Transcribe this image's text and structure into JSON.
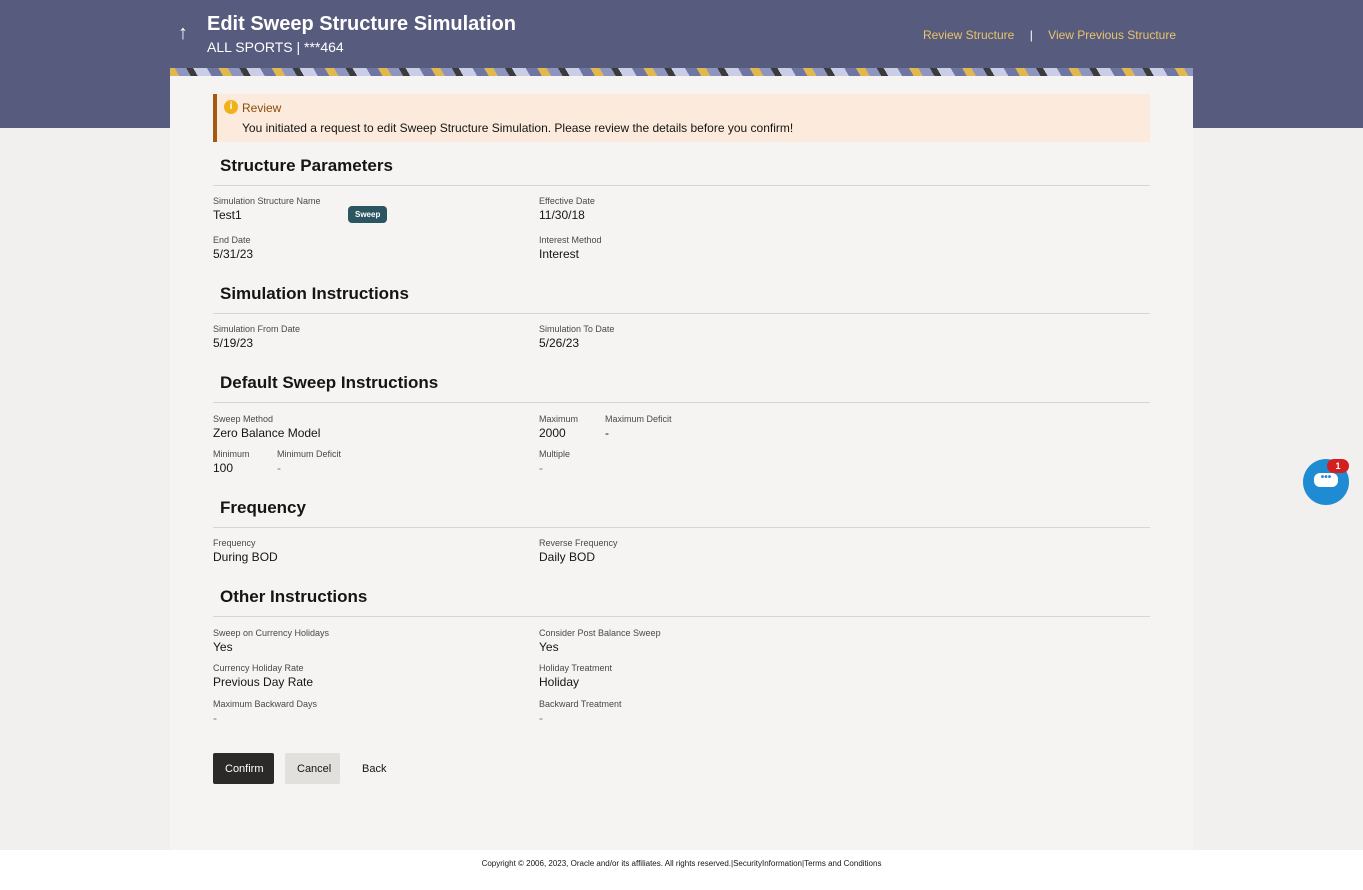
{
  "header": {
    "title": "Edit Sweep Structure Simulation",
    "subtitle": "ALL SPORTS | ***464",
    "links": [
      "Review Structure",
      "View Previous Structure"
    ],
    "separator": "|"
  },
  "alert": {
    "title": "Review",
    "message": "You initiated a request to edit Sweep Structure Simulation. Please review the details before you confirm!"
  },
  "sections": {
    "structure": {
      "title": "Structure Parameters",
      "badge": "Sweep",
      "fields": [
        {
          "label": "Simulation Structure Name",
          "value": "Test1"
        },
        {
          "label": "Effective Date",
          "value": "11/30/18"
        },
        {
          "label": "End Date",
          "value": "5/31/23"
        },
        {
          "label": "Interest Method",
          "value": "Interest"
        }
      ]
    },
    "simulation": {
      "title": "Simulation Instructions",
      "fields": [
        {
          "label": "Simulation From Date",
          "value": "5/19/23"
        },
        {
          "label": "Simulation To Date",
          "value": "5/26/23"
        }
      ]
    },
    "default": {
      "title": "Default Sweep Instructions",
      "fields": [
        {
          "label": "Sweep Method",
          "value": "Zero Balance Model"
        },
        {
          "label": "Maximum",
          "value": "2000"
        },
        {
          "label": "Maximum Deficit",
          "value": "-"
        },
        {
          "label": "Minimum",
          "value": "100"
        },
        {
          "label": "Minimum Deficit",
          "value": "-"
        },
        {
          "label": "Multiple",
          "value": "-"
        }
      ]
    },
    "frequency": {
      "title": "Frequency",
      "fields": [
        {
          "label": "Frequency",
          "value": "During BOD"
        },
        {
          "label": "Reverse Frequency",
          "value": "Daily BOD"
        }
      ]
    },
    "other": {
      "title": "Other Instructions",
      "fields": [
        {
          "label": "Sweep on Currency Holidays",
          "value": "Yes"
        },
        {
          "label": "Consider Post Balance Sweep",
          "value": "Yes"
        },
        {
          "label": "Currency Holiday Rate",
          "value": "Previous Day Rate"
        },
        {
          "label": "Holiday Treatment",
          "value": "Holiday"
        },
        {
          "label": "Maximum Backward Days",
          "value": "-"
        },
        {
          "label": "Backward Treatment",
          "value": "-"
        }
      ]
    }
  },
  "buttons": {
    "confirm": "Confirm",
    "cancel": "Cancel",
    "back": "Back"
  },
  "footer": "Copyright © 2006, 2023, Oracle and/or its affiliates. All rights reserved.|SecurityInformation|Terms and Conditions",
  "chat": {
    "badge_count": "1",
    "icon": "chat-bubble-icon"
  },
  "colors": {
    "header": "#575b7d",
    "accent": "#e8c46a",
    "primary_button": "#2b2a28",
    "badge": "#2b5560"
  }
}
